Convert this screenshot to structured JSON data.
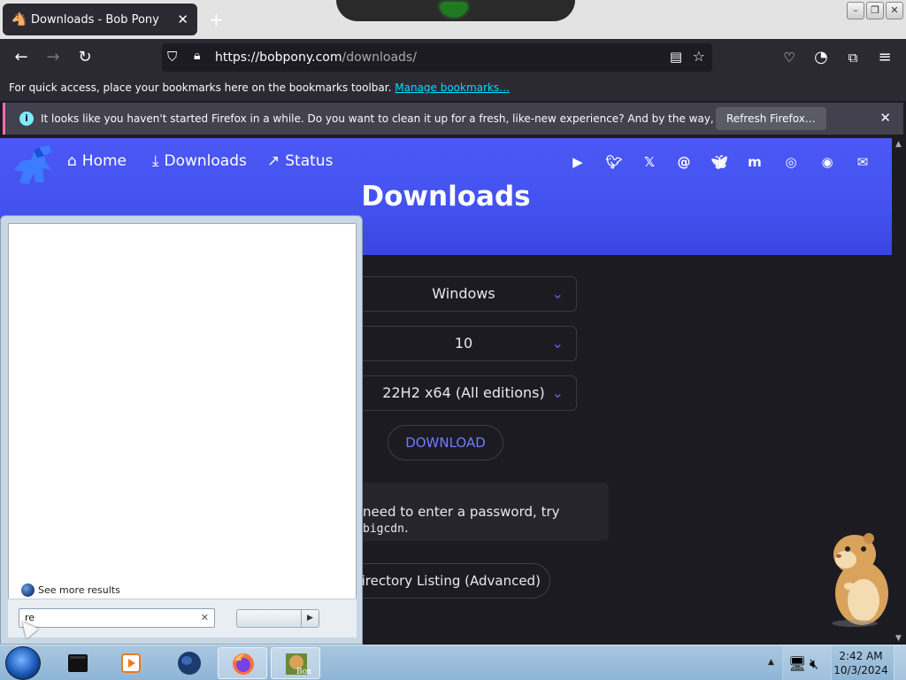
{
  "browser": {
    "tab_title": "Downloads - Bob Pony",
    "tab_close": "✕",
    "new_tab": "+",
    "url_host": "https://bobpony.com",
    "url_path": "/downloads/",
    "bookmarks_text": "For quick access, place your bookmarks here on the bookmarks toolbar.",
    "bookmarks_link": "Manage bookmarks…",
    "notice_text": "It looks like you haven't started Firefox in a while. Do you want to clean it up for a fresh, like-new experience? And by the way, welcome back!",
    "notice_button": "Refresh Firefox…"
  },
  "site": {
    "nav": [
      {
        "label": "Home",
        "icon": "home-icon"
      },
      {
        "label": "Downloads",
        "icon": "download-icon"
      },
      {
        "label": "Status",
        "icon": "trending-icon"
      }
    ],
    "social_icons": [
      "youtube-icon",
      "twitter-icon",
      "x-icon",
      "threads-icon",
      "bluesky-icon",
      "mastodon-icon",
      "discord-icon",
      "github-icon",
      "email-icon"
    ],
    "heading": "Downloads",
    "select_os": "Windows",
    "select_version": "10",
    "select_build": "22H2 x64 (All editions)",
    "download_button": "DOWNLOAD",
    "password_text": "need to enter a password, try ",
    "password_code": "bigcdn",
    "password_end": ".",
    "directory_button": "Directory Listing (Advanced)",
    "accent": "#4b58f5"
  },
  "start_menu": {
    "see_more": "See more results",
    "search_value": "re",
    "clear": "✕"
  },
  "taskbar": {
    "time": "2:42 AM",
    "date": "10/3/2024",
    "box_label": "Box"
  }
}
